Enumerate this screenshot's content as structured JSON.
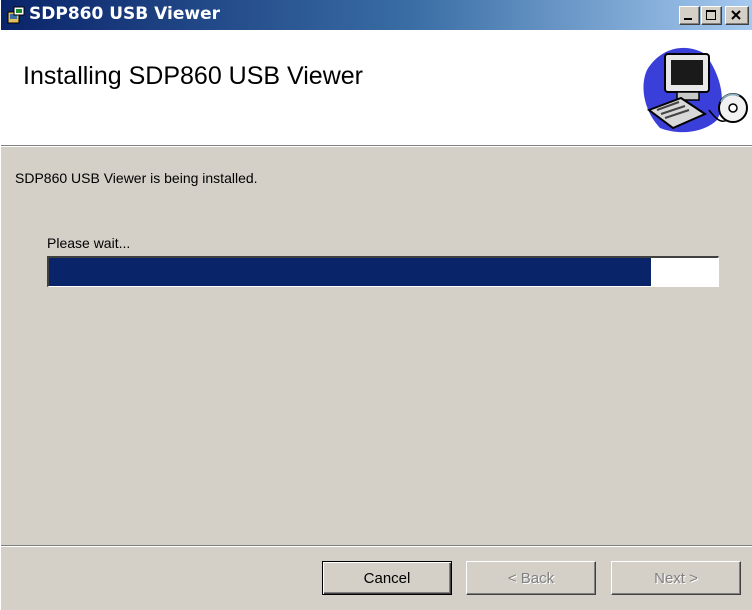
{
  "window": {
    "title": "SDP860 USB Viewer",
    "controls": [
      "minimize-icon",
      "maximize-icon",
      "close-icon"
    ],
    "app_icon": "installer-icon"
  },
  "header": {
    "title": "Installing SDP860 USB Viewer",
    "art_icon": "computer-disc-icon"
  },
  "main": {
    "status": "SDP860 USB Viewer is being installed.",
    "wait_label": "Please wait...",
    "progress": 0.9
  },
  "footer": {
    "cancel_label": "Cancel",
    "back_label": "< Back",
    "next_label": "Next >"
  },
  "colors": {
    "titlebar_start": "#0a246a",
    "titlebar_end": "#a6caf0",
    "progress_fill": "#0a246a",
    "dialog_bg": "#d4d0c8"
  }
}
